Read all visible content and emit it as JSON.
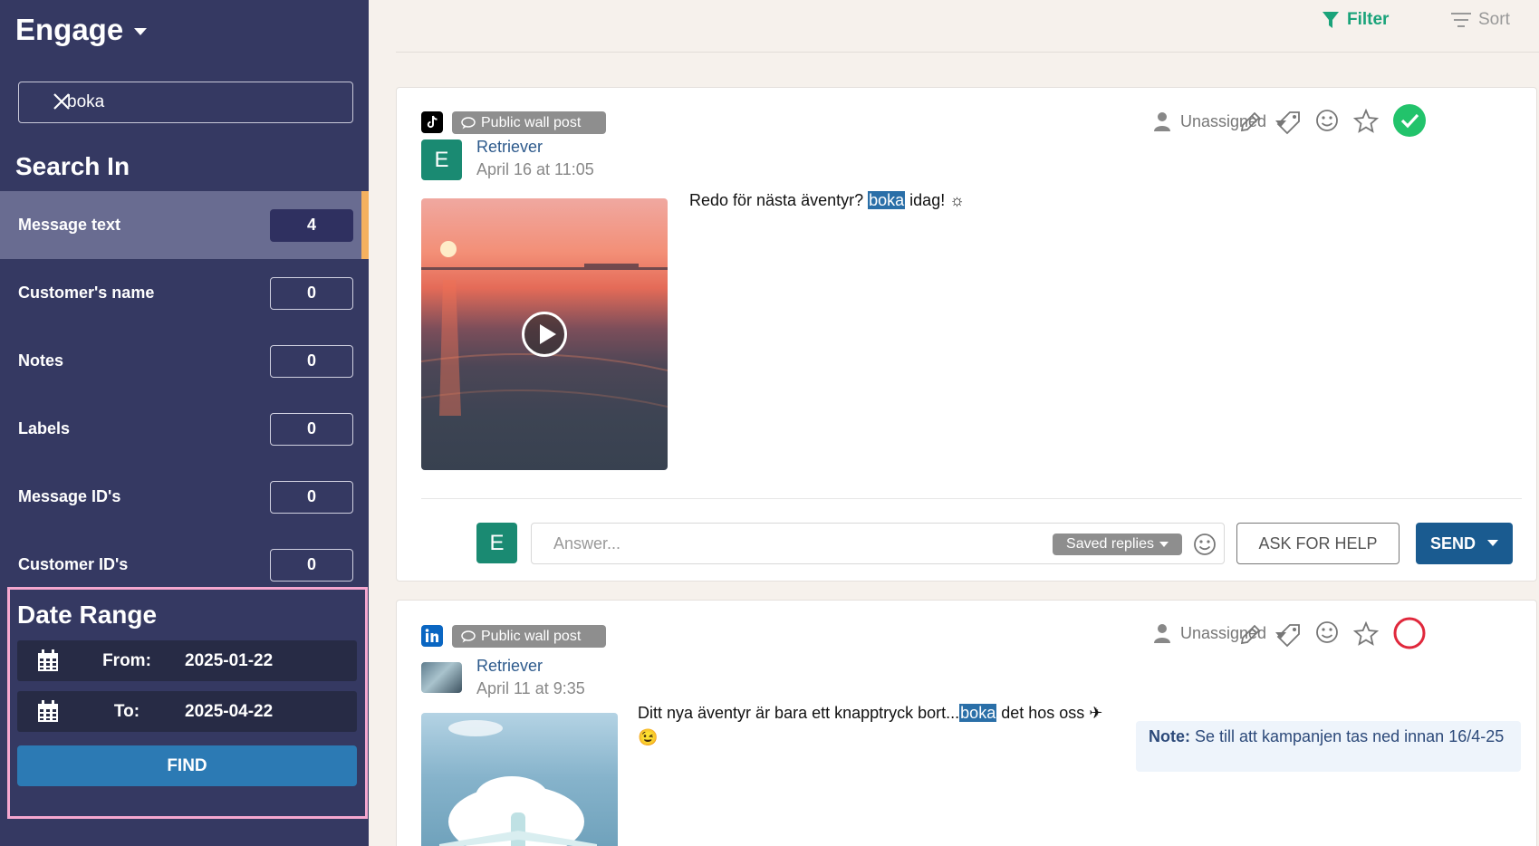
{
  "app": {
    "title": "Engage"
  },
  "search": {
    "query": "boka"
  },
  "search_in": {
    "title": "Search In",
    "items": [
      {
        "label": "Message text",
        "count": "4"
      },
      {
        "label": "Customer's name",
        "count": "0"
      },
      {
        "label": "Notes",
        "count": "0"
      },
      {
        "label": "Labels",
        "count": "0"
      },
      {
        "label": "Message ID's",
        "count": "0"
      },
      {
        "label": "Customer ID's",
        "count": "0"
      }
    ]
  },
  "date_range": {
    "title": "Date Range",
    "from_label": "From:",
    "from_value": "2025-01-22",
    "to_label": "To:",
    "to_value": "2025-04-22",
    "find_label": "FIND"
  },
  "toolbar": {
    "filter_label": "Filter",
    "sort_label": "Sort"
  },
  "posts": [
    {
      "channel": "tiktok",
      "badge": "Public wall post",
      "author": "Retriever",
      "author_initial": "E",
      "date": "April 16 at 11:05",
      "assignee": "Unassigned",
      "text_before": "Redo för nästa äventyr? ",
      "highlight": "boka",
      "text_after": " idag! ☼",
      "status": "done"
    },
    {
      "channel": "linkedin",
      "badge": "Public wall post",
      "author": "Retriever",
      "date": "April 11 at 9:35",
      "assignee": "Unassigned",
      "text_before": "Ditt nya äventyr är bara ett knapptryck bort...",
      "highlight": "boka",
      "text_after": " det hos oss ✈",
      "text_line2": "😉",
      "note_label": "Note:",
      "note_text": "Se till att kampanjen tas ned innan 16/4-25",
      "status": "open"
    }
  ],
  "reply": {
    "avatar_initial": "E",
    "placeholder": "Answer...",
    "saved_replies_label": "Saved replies",
    "ask_help_label": "ASK FOR HELP",
    "send_label": "SEND"
  },
  "colors": {
    "sidebar_bg": "#353962",
    "active_row": "#696c91",
    "accent_orange": "#f5b15f",
    "highlight_border": "#f5a7cf",
    "find_button": "#2c7ab4",
    "send_button": "#1a5b90",
    "filter_green": "#1aa37a",
    "done_green": "#22c36b",
    "open_red": "#e0283c"
  }
}
